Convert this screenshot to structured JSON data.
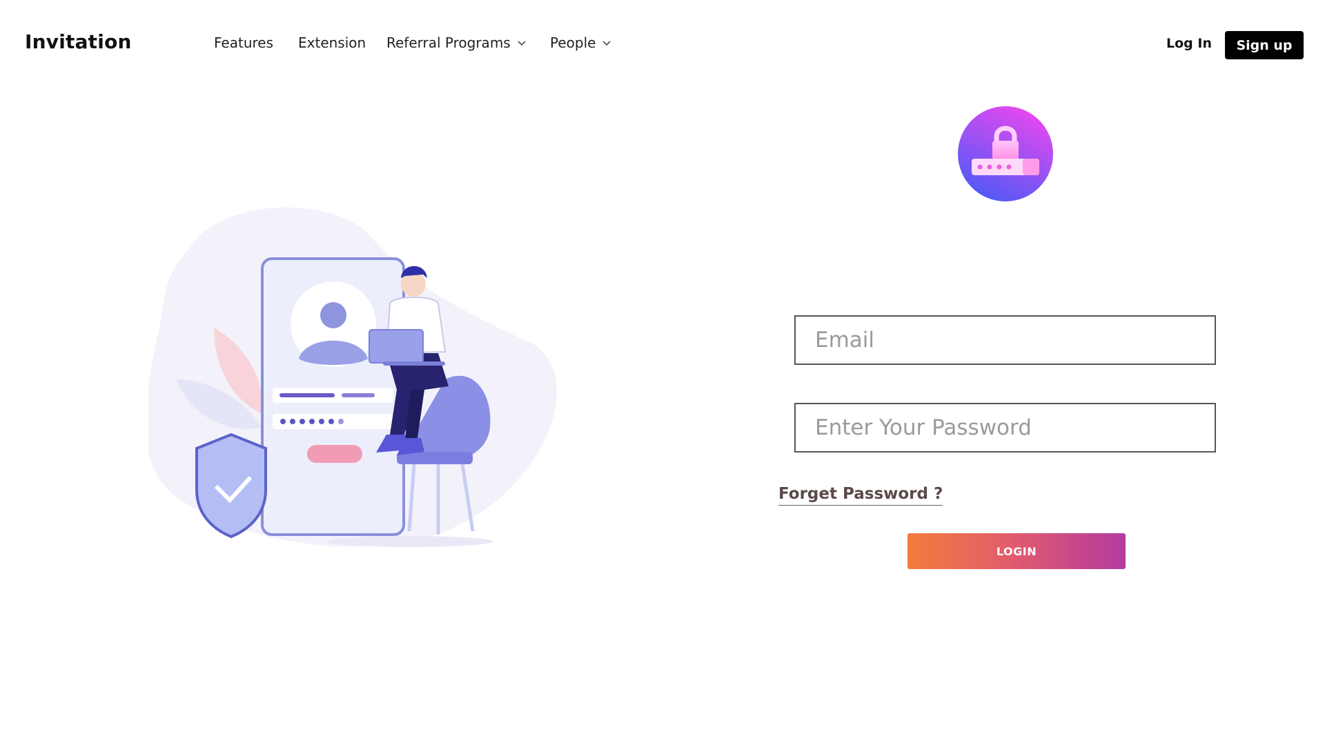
{
  "header": {
    "brand": "Invitation",
    "nav": [
      {
        "label": "Features",
        "has_dropdown": false
      },
      {
        "label": "Extension",
        "has_dropdown": false
      },
      {
        "label": "Referral Programs",
        "has_dropdown": true
      },
      {
        "label": "People",
        "has_dropdown": true
      }
    ],
    "login_label": "Log In",
    "signup_label": "Sign up"
  },
  "form": {
    "email_placeholder": "Email",
    "email_value": "",
    "password_placeholder": "Enter Your Password",
    "password_value": "",
    "forgot_label": "Forget Password ?",
    "submit_label": "LOGIN"
  },
  "icons": {
    "lock_badge": "lock-password-icon",
    "dropdown": "chevron-down-icon"
  },
  "colors": {
    "signup_bg": "#000000",
    "badge_gradient": [
      "#e94bf3",
      "#4f5bf7"
    ],
    "login_gradient": [
      "#f47c3c",
      "#b43aa0"
    ],
    "forgot_text": "#5b4a4a"
  }
}
